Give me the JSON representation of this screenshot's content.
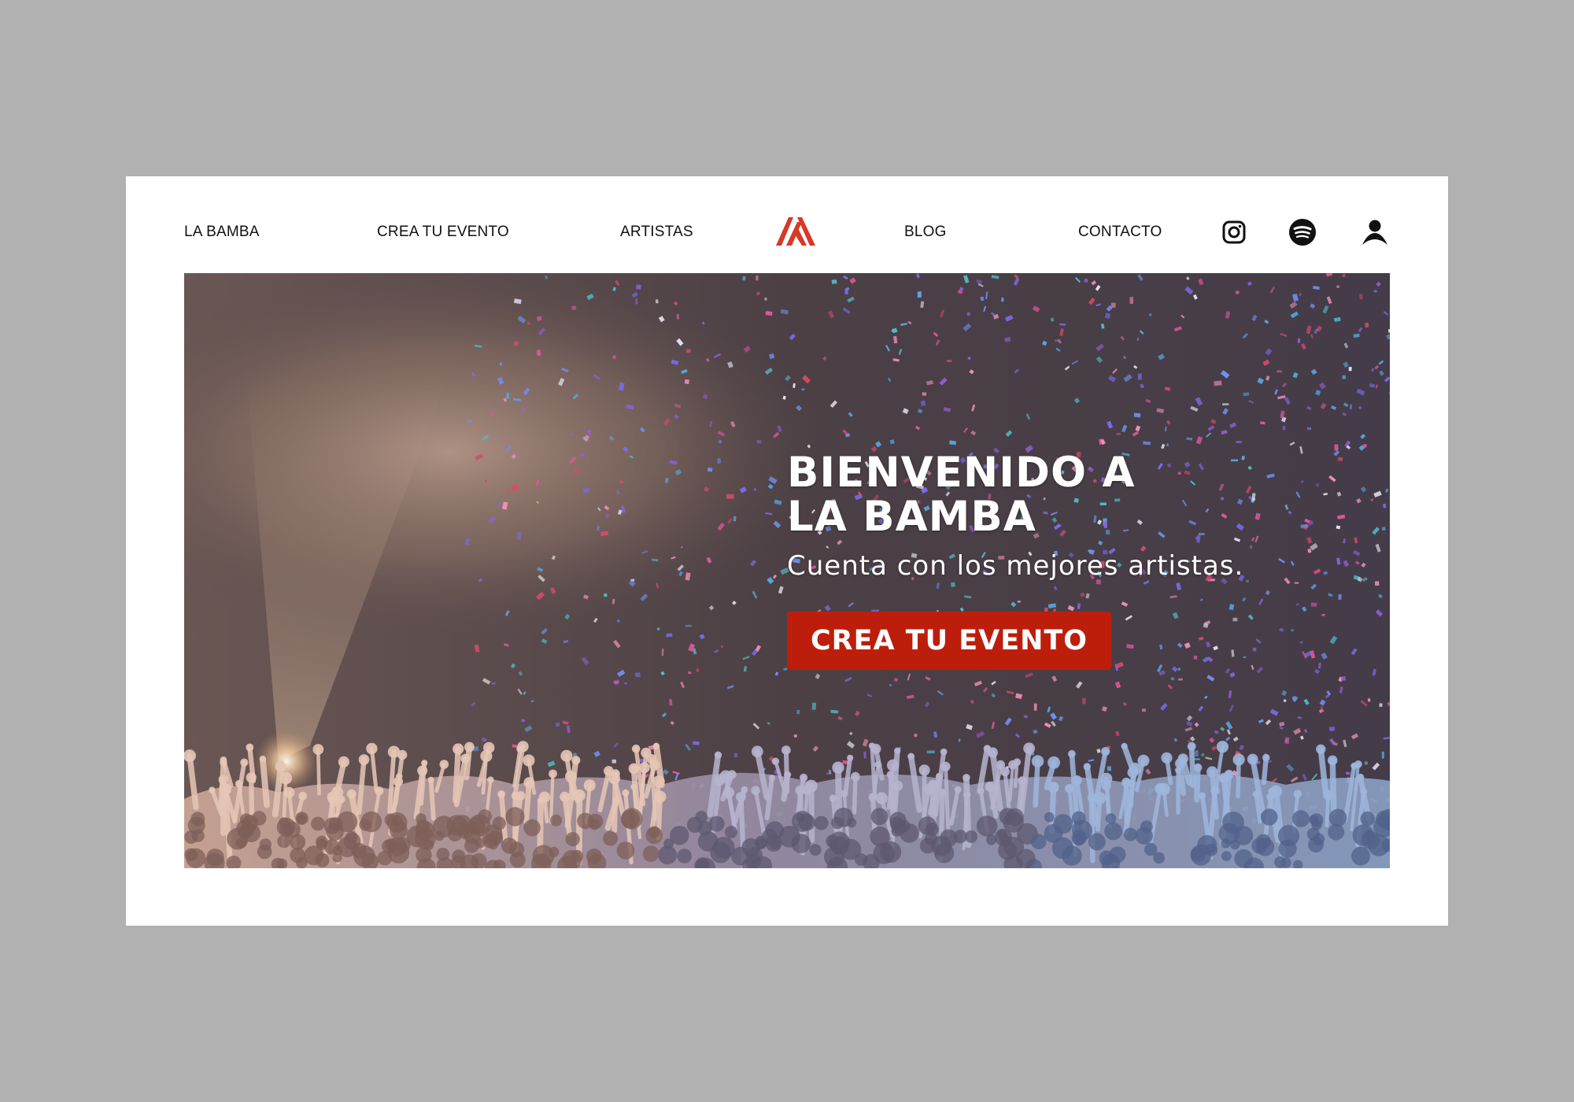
{
  "nav": {
    "links": [
      {
        "label": "LA BAMBA"
      },
      {
        "label": "CREA TU EVENTO"
      },
      {
        "label": "ARTISTAS"
      },
      {
        "label": "BLOG"
      },
      {
        "label": "CONTACTO"
      }
    ],
    "logo_icon": "la-bamba-logo",
    "social_icons": [
      "instagram-icon",
      "spotify-icon",
      "user-icon"
    ]
  },
  "hero": {
    "title_line1": "BIENVENIDO A",
    "title_line2": "LA BAMBA",
    "subtitle": "Cuenta con los mejores artistas.",
    "cta_label": "CREA TU EVENTO",
    "background_image": "concert-crowd-confetti"
  },
  "colors": {
    "page_background": "#b1b1b1",
    "card_background": "#ffffff",
    "accent": "#bd1e0b",
    "logo_red": "#d63a27",
    "text_dark": "#111111",
    "text_light": "#ffffff"
  }
}
